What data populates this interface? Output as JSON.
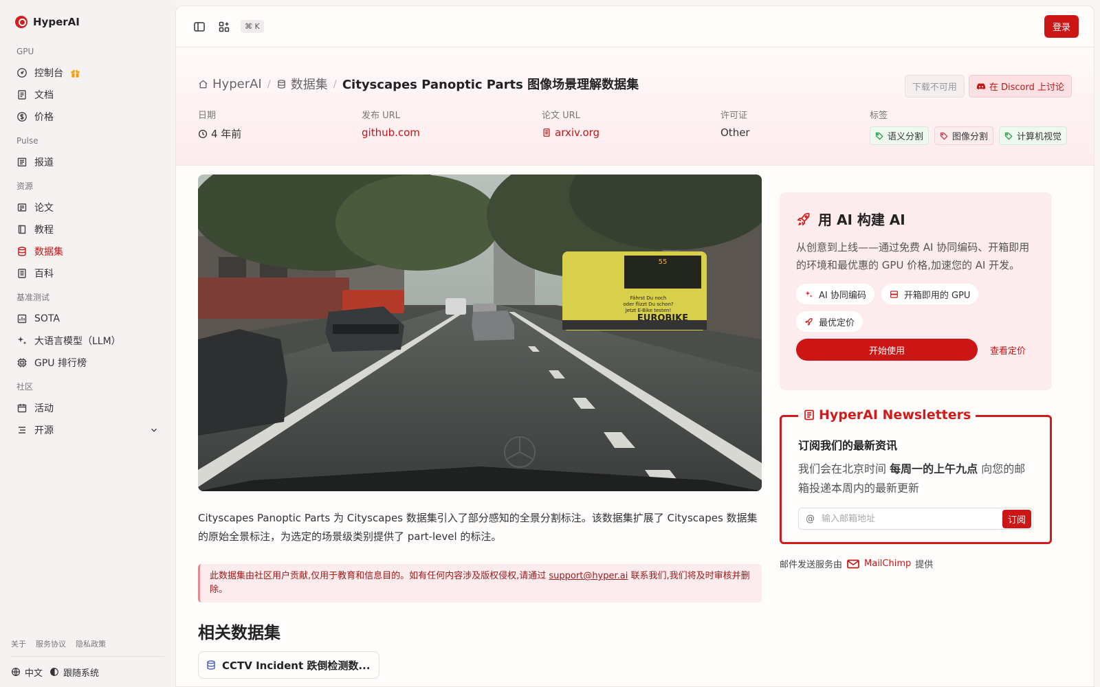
{
  "brand": {
    "name": "HyperAI"
  },
  "sidebar": {
    "groups": [
      {
        "label": "GPU",
        "items": [
          {
            "label": "控制台"
          },
          {
            "label": "文档"
          },
          {
            "label": "价格"
          }
        ]
      },
      {
        "label": "Pulse",
        "items": [
          {
            "label": "报道"
          }
        ]
      },
      {
        "label": "资源",
        "items": [
          {
            "label": "论文"
          },
          {
            "label": "教程"
          },
          {
            "label": "数据集"
          },
          {
            "label": "百科"
          }
        ]
      },
      {
        "label": "基准测试",
        "items": [
          {
            "label": "SOTA"
          },
          {
            "label": "大语言模型（LLM）"
          },
          {
            "label": "GPU 排行榜"
          }
        ]
      },
      {
        "label": "社区",
        "items": [
          {
            "label": "活动"
          },
          {
            "label": "开源"
          }
        ]
      }
    ],
    "active_item": "数据集",
    "footer_links": [
      "关于",
      "服务协议",
      "隐私政策"
    ],
    "language": "中文",
    "theme": "跟随系统"
  },
  "topbar": {
    "shortcut": "⌘ K",
    "login": "登录"
  },
  "breadcrumb": {
    "home": "HyperAI",
    "section": "数据集",
    "current": "Cityscapes Panoptic Parts 图像场景理解数据集"
  },
  "actions": {
    "download": "下载不可用",
    "discord": "在 Discord 上讨论"
  },
  "meta": {
    "date_label": "日期",
    "date_value": "4 年前",
    "release_label": "发布 URL",
    "release_value": "github.com",
    "paper_label": "论文 URL",
    "paper_value": "arxiv.org",
    "license_label": "许可证",
    "license_value": "Other",
    "tags_label": "标签",
    "tags": [
      "语义分割",
      "图像分割",
      "计算机视觉"
    ]
  },
  "description": "Cityscapes Panoptic Parts 为 Cityscapes 数据集引入了部分感知的全景分割标注。该数据集扩展了 Cityscapes 数据集的原始全景标注，为选定的场景级类别提供了 part-level 的标注。",
  "notice": {
    "before": "此数据集由社区用户贡献,仅用于教育和信息目的。如有任何内容涉及版权侵权,请通过 ",
    "email": "support@hyper.ai",
    "after": " 联系我们,我们将及时审核并删除。"
  },
  "related": {
    "title": "相关数据集",
    "items": [
      {
        "label": "CCTV Incident 跌倒检测数..."
      }
    ]
  },
  "photo": {
    "bus_sign": "55",
    "bus_ad": "EUROBIKE",
    "bus_text1": "Fährst Du noch",
    "bus_text2": "oder flizzt Du schon?",
    "bus_text3": "Jetzt E-Bike testen!"
  },
  "promo": {
    "title": "用 AI 构建 AI",
    "text": "从创意到上线——通过免费 AI 协同编码、开箱即用的环境和最优惠的 GPU 价格,加速您的 AI 开发。",
    "chips": [
      "AI 协同编码",
      "开箱即用的 GPU",
      "最优定价"
    ],
    "start": "开始使用",
    "pricing": "查看定价"
  },
  "newsletter": {
    "legend": "HyperAI Newsletters",
    "heading": "订阅我们的最新资讯",
    "text_before": "我们会在北京时间 ",
    "text_bold": "每周一的上午九点",
    "text_after": " 向您的邮箱投递本周内的最新更新",
    "placeholder": "输入邮箱地址",
    "subscribe": "订阅"
  },
  "mailchimp": {
    "before": "邮件发送服务由",
    "brand": "MailChimp",
    "after": "提供"
  },
  "colors": {
    "accent": "#cc1616",
    "sidebar_bg": "#f6f2f1",
    "hero_tint": "#fdecee"
  }
}
